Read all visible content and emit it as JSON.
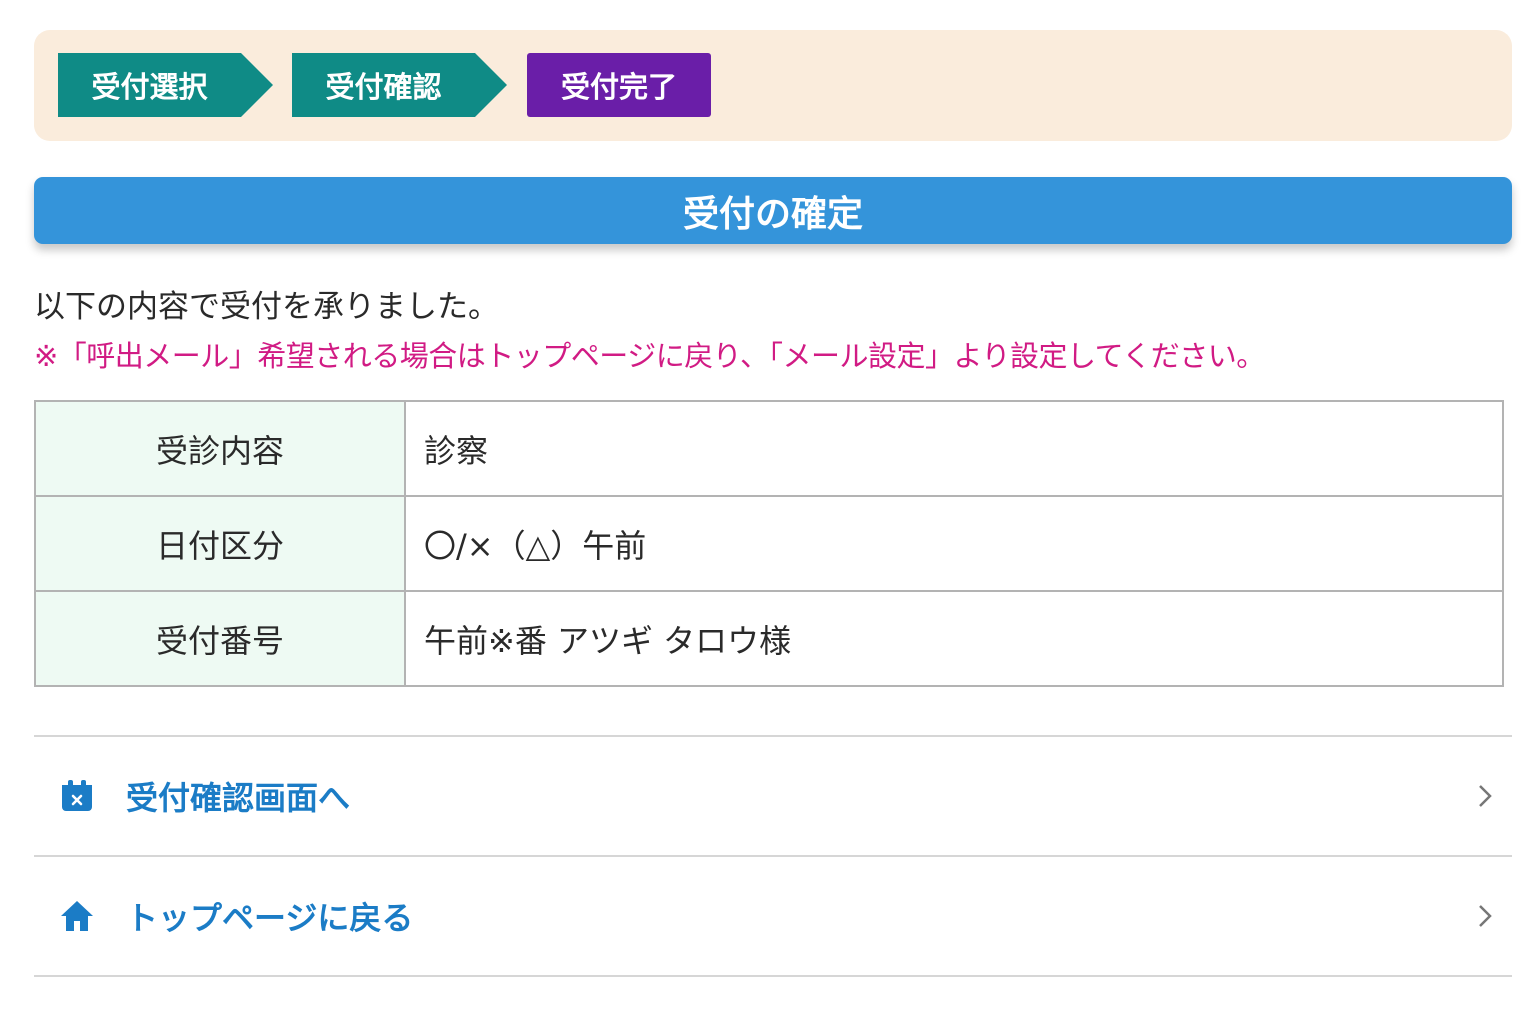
{
  "steps": [
    {
      "label": "受付選択"
    },
    {
      "label": "受付確認"
    },
    {
      "label": "受付完了"
    }
  ],
  "title": "受付の確定",
  "message": "以下の内容で受付を承りました。",
  "note": "※「呼出メール」希望される場合はトップページに戻り、「メール設定」より設定してください。",
  "table": [
    {
      "header": "受診内容",
      "value": "診察"
    },
    {
      "header": "日付区分",
      "value": "〇/×（△）午前"
    },
    {
      "header": "受付番号",
      "value": "午前※番 アツギ タロウ様"
    }
  ],
  "links": [
    {
      "label": "受付確認画面へ",
      "icon": "calendar-icon"
    },
    {
      "label": "トップページに戻る",
      "icon": "home-icon"
    }
  ],
  "colors": {
    "step_done": "#0f8b86",
    "step_current": "#6a1ea8",
    "title_bar": "#3494da",
    "note_text": "#d11b84",
    "link_text": "#1b7cc6"
  }
}
